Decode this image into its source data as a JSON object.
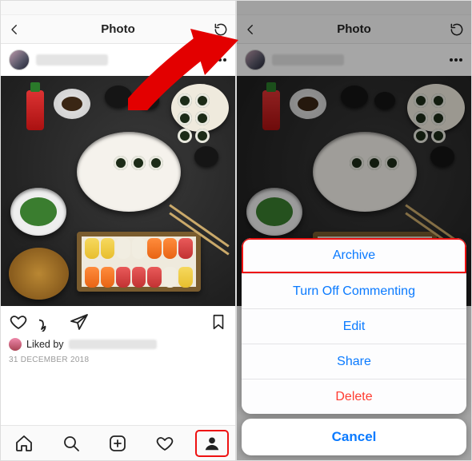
{
  "header": {
    "title": "Photo"
  },
  "liked": {
    "prefix": "Liked by"
  },
  "date": "31 DECEMBER 2018",
  "icons": {
    "back": "chevron-left",
    "refresh": "refresh",
    "more": "ellipsis",
    "heart": "heart",
    "comment": "comment",
    "send": "paper-plane",
    "bookmark": "bookmark",
    "home": "home",
    "search": "search",
    "add": "add-square",
    "activity": "heart",
    "profile": "profile"
  },
  "sheet": {
    "items": [
      {
        "label": "Archive",
        "highlight": true
      },
      {
        "label": "Turn Off Commenting"
      },
      {
        "label": "Edit"
      },
      {
        "label": "Share"
      },
      {
        "label": "Delete",
        "destructive": true
      }
    ],
    "cancel": "Cancel"
  }
}
